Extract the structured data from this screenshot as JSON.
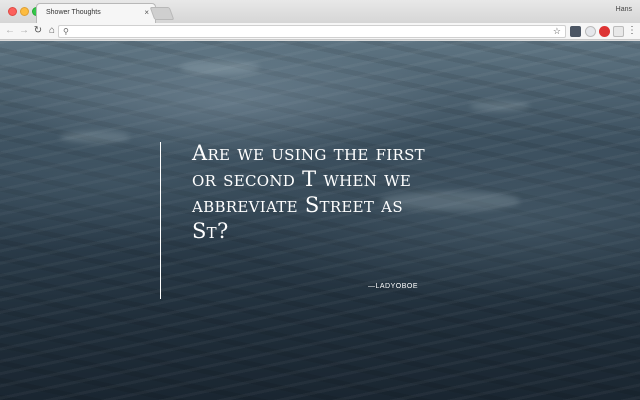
{
  "browser": {
    "tab_title": "Shower Thoughts",
    "tab_close": "×",
    "profile_name": "Hans",
    "address_value": "",
    "icons": {
      "back": "←",
      "forward": "→",
      "reload": "↻",
      "home": "⌂",
      "search": "⚲",
      "star": "☆",
      "menu": "⋮"
    },
    "extensions": [
      "extension-dark",
      "extension-circle",
      "extension-red-badge",
      "extension-gray"
    ]
  },
  "quote": {
    "text": "Are we using the first or second T when we abbreviate Street as St?",
    "author": "—LADYOBOE"
  },
  "colors": {
    "quote_text": "#ffffff",
    "background_dark": "#1f2d39",
    "background_light": "#5e7482"
  }
}
